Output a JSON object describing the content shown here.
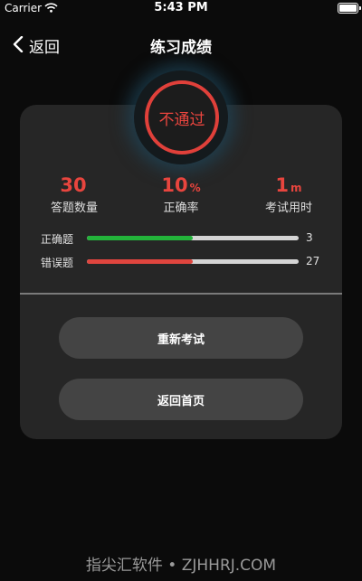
{
  "status_bar": {
    "carrier": "Carrier",
    "time": "5:43 PM"
  },
  "nav": {
    "back_label": "返回",
    "title": "练习成绩"
  },
  "result": {
    "badge": "不通过"
  },
  "stats": [
    {
      "value": "30",
      "unit": "",
      "label": "答题数量"
    },
    {
      "value": "10",
      "unit": "%",
      "label": "正确率"
    },
    {
      "value": "1",
      "unit": "m",
      "label": "考试用时"
    }
  ],
  "bars": {
    "correct": {
      "label": "正确题",
      "value": "3",
      "fill_fraction": 0.5,
      "color": "#23b33a"
    },
    "wrong": {
      "label": "错误题",
      "value": "27",
      "fill_fraction": 0.5,
      "color": "#e0453e"
    }
  },
  "buttons": {
    "retry": "重新考试",
    "home": "返回首页"
  },
  "watermark": "指尖汇软件 • ZJHHRJ.COM",
  "colors": {
    "accent_red": "#e8453e",
    "accent_green": "#23b33a",
    "background": "#0b0b0b",
    "card": "#262626"
  }
}
